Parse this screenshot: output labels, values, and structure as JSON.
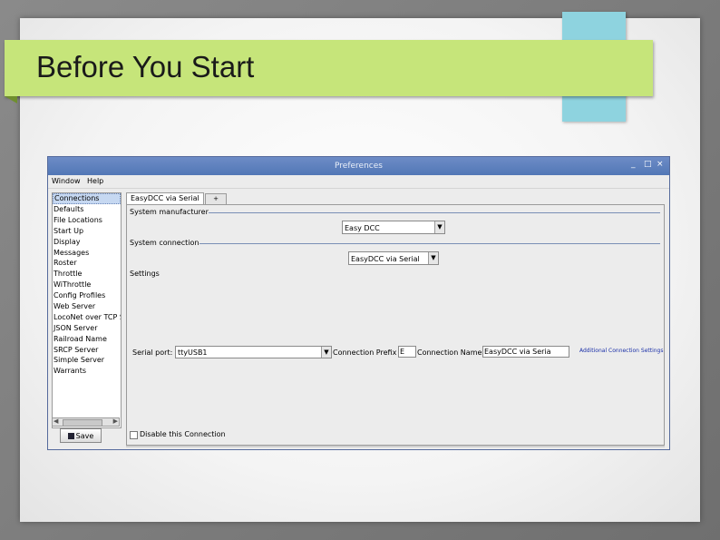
{
  "slide": {
    "title": "Before You Start",
    "colors": {
      "banner": "#c6e57a",
      "accent_block": "#8ed3df"
    }
  },
  "window": {
    "title": "Preferences",
    "controls": {
      "minimize": "_",
      "maximize": "□",
      "close": "×"
    },
    "menu": [
      "Window",
      "Help"
    ],
    "sidebar": {
      "items": [
        "Connections",
        "Defaults",
        "File Locations",
        "Start Up",
        "Display",
        "Messages",
        "Roster",
        "Throttle",
        "WiThrottle",
        "Config Profiles",
        "Web Server",
        "LocoNet over TCP S",
        "JSON Server",
        "Railroad Name",
        "SRCP Server",
        "Simple Server",
        "Warrants"
      ],
      "selected": "Connections"
    },
    "save_label": "Save",
    "tabs": {
      "active": "EasyDCC via Serial",
      "add": "+"
    },
    "system_manufacturer": {
      "label": "System manufacturer",
      "value": "Easy DCC"
    },
    "system_connection": {
      "label": "System connection",
      "value": "EasyDCC via Serial"
    },
    "settings": {
      "label": "Settings",
      "serial_port_label": "Serial port:",
      "serial_port_value": "ttyUSB1",
      "connection_prefix_label": "Connection Prefix",
      "connection_prefix_value": "E",
      "connection_name_label": "Connection Name:",
      "connection_name_value": "EasyDCC via Seria",
      "additional_settings_link": "Additional Connection Settings"
    },
    "disable_label": "Disable this Connection"
  }
}
